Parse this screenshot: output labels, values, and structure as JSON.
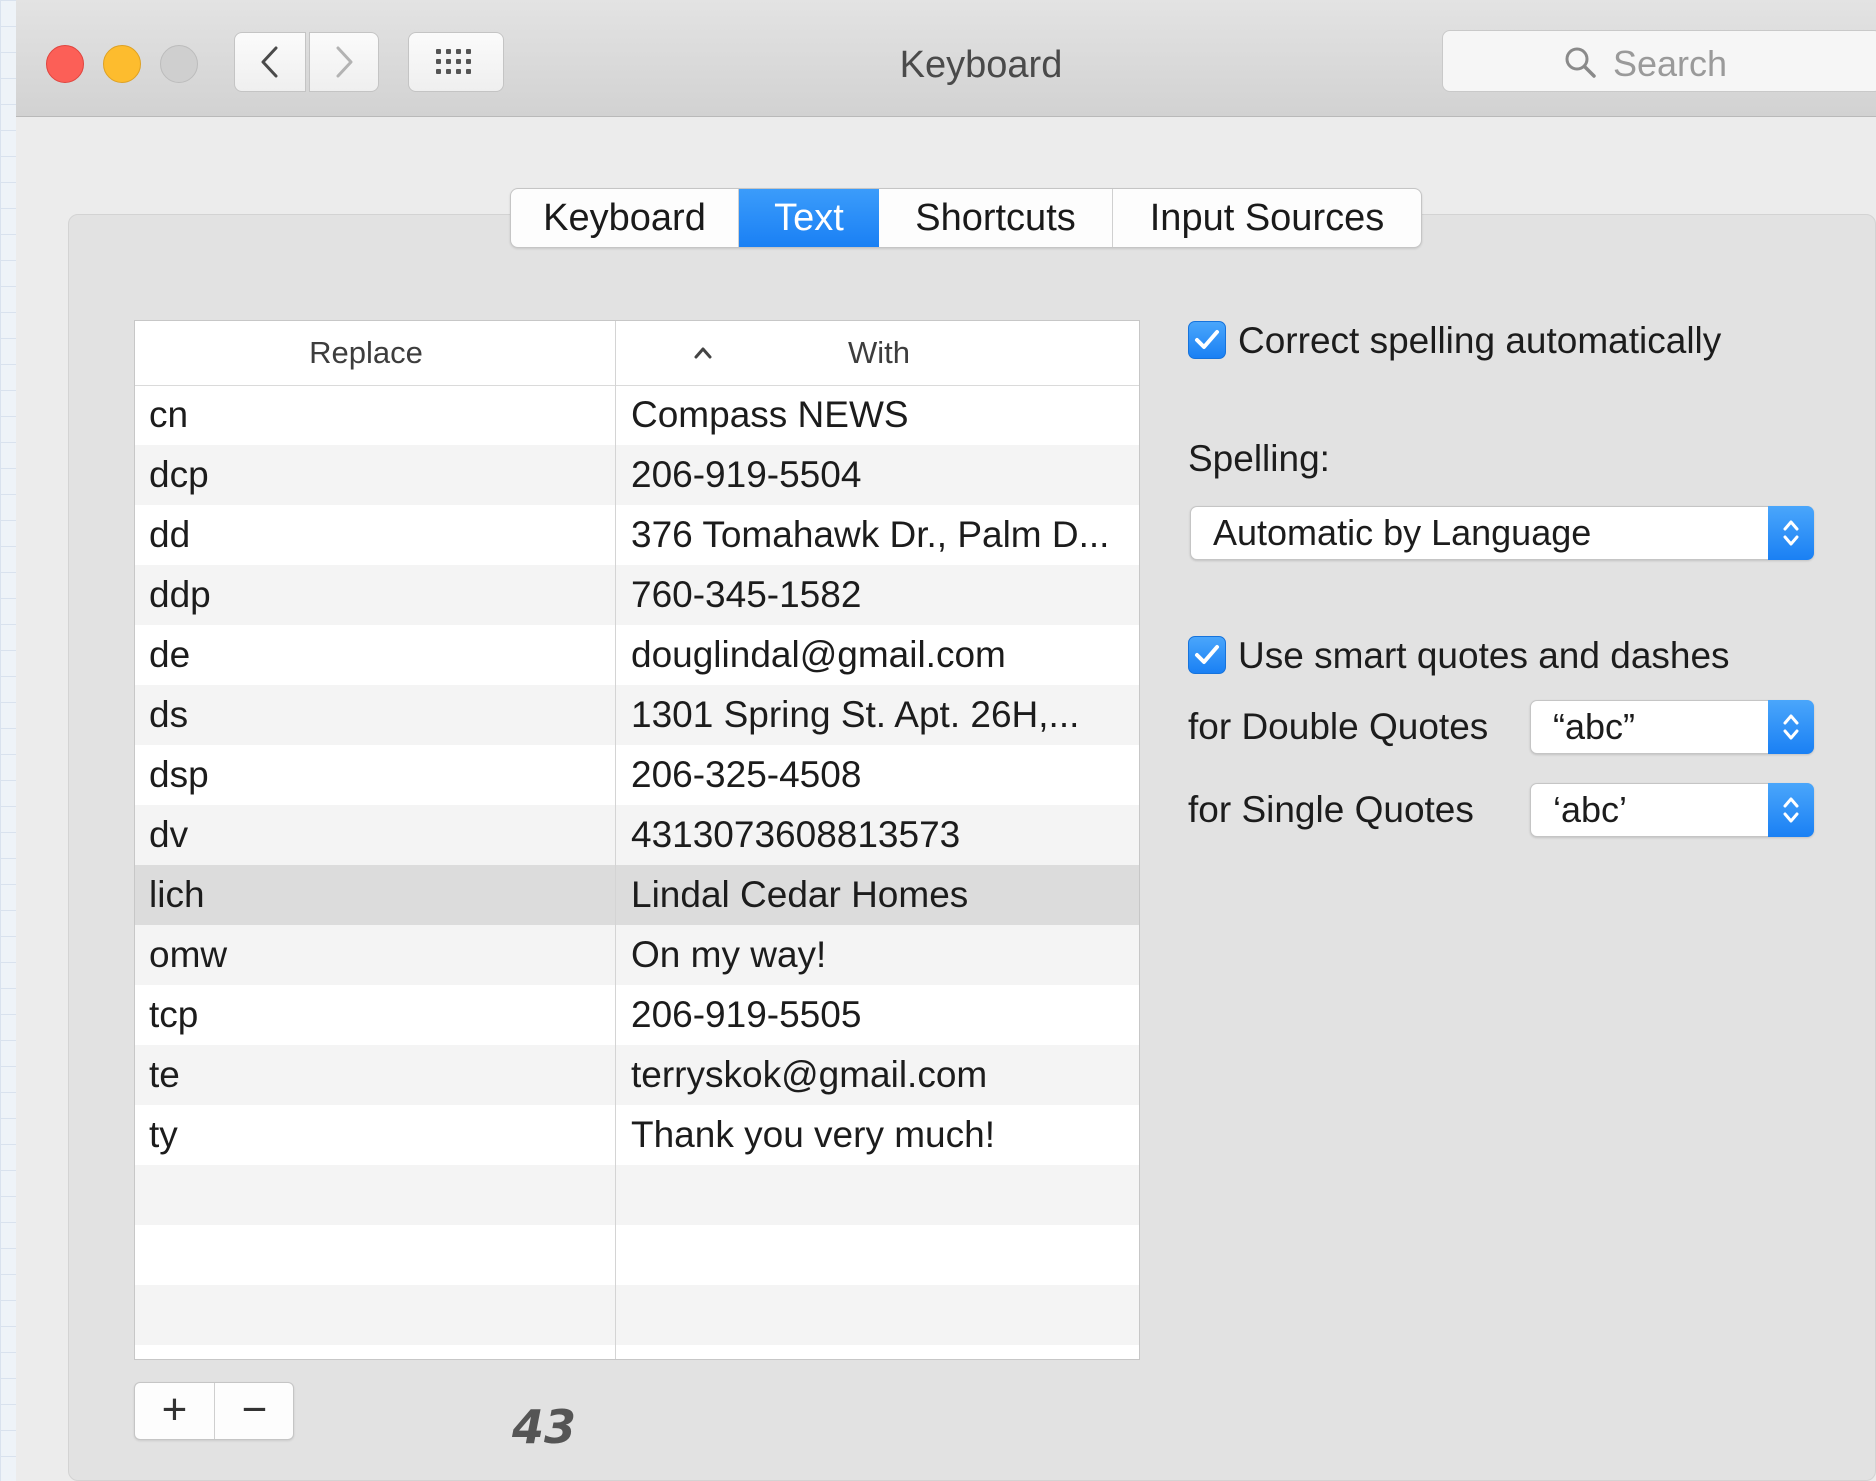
{
  "window": {
    "title": "Keyboard",
    "search_placeholder": "Search"
  },
  "tabs": [
    {
      "label": "Keyboard",
      "active": false
    },
    {
      "label": "Text",
      "active": true
    },
    {
      "label": "Shortcuts",
      "active": false
    },
    {
      "label": "Input Sources",
      "active": false
    }
  ],
  "table": {
    "columns": {
      "replace": "Replace",
      "with": "With"
    },
    "rows": [
      {
        "replace": "cn",
        "with": "Compass NEWS"
      },
      {
        "replace": "dcp",
        "with": "206-919-5504"
      },
      {
        "replace": "dd",
        "with": "376 Tomahawk Dr., Palm D..."
      },
      {
        "replace": "ddp",
        "with": "760-345-1582"
      },
      {
        "replace": "de",
        "with": "douglindal@gmail.com"
      },
      {
        "replace": "ds",
        "with": "1301 Spring St. Apt. 26H,..."
      },
      {
        "replace": "dsp",
        "with": "206-325-4508"
      },
      {
        "replace": "dv",
        "with": "4313073608813573"
      },
      {
        "replace": "lich",
        "with": "Lindal Cedar Homes",
        "selected": true
      },
      {
        "replace": "omw",
        "with": "On my way!"
      },
      {
        "replace": "tcp",
        "with": "206-919-5505"
      },
      {
        "replace": "te",
        "with": "terryskok@gmail.com"
      },
      {
        "replace": "ty",
        "with": "Thank you very much!"
      }
    ]
  },
  "controls": {
    "add_label": "+",
    "remove_label": "−"
  },
  "options": {
    "correct_spelling": {
      "label": "Correct spelling automatically",
      "checked": true
    },
    "spelling_label": "Spelling:",
    "spelling_value": "Automatic by Language",
    "smart_quotes": {
      "label": "Use smart quotes and dashes",
      "checked": true
    },
    "double_quotes_label": "for Double Quotes",
    "double_quotes_value": "“abc”",
    "single_quotes_label": "for Single Quotes",
    "single_quotes_value": "‘abc’"
  },
  "page_number": "43",
  "colors": {
    "accent": "#1a80f4",
    "close": "#fc5f57",
    "minimize": "#fdbc2e",
    "zoom": "#cfcfcf"
  }
}
